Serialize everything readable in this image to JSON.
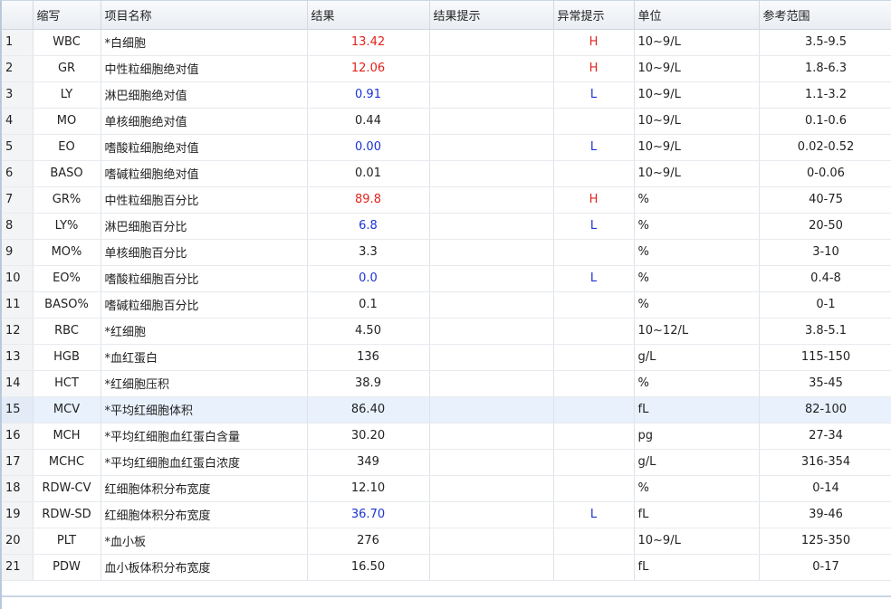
{
  "columns": {
    "abbr": "缩写",
    "name": "项目名称",
    "result": "结果",
    "hint": "结果提示",
    "flag": "异常提示",
    "unit": "单位",
    "range": "参考范围"
  },
  "rows": [
    {
      "no": "1",
      "abbr": "WBC",
      "name": "*白细胞",
      "result": "13.42",
      "hint": "",
      "flag": "H",
      "unit": "10~9/L",
      "range": "3.5-9.5"
    },
    {
      "no": "2",
      "abbr": "GR",
      "name": "中性粒细胞绝对值",
      "result": "12.06",
      "hint": "",
      "flag": "H",
      "unit": "10~9/L",
      "range": "1.8-6.3"
    },
    {
      "no": "3",
      "abbr": "LY",
      "name": "淋巴细胞绝对值",
      "result": "0.91",
      "hint": "",
      "flag": "L",
      "unit": "10~9/L",
      "range": "1.1-3.2"
    },
    {
      "no": "4",
      "abbr": "MO",
      "name": "单核细胞绝对值",
      "result": "0.44",
      "hint": "",
      "flag": "",
      "unit": "10~9/L",
      "range": "0.1-0.6"
    },
    {
      "no": "5",
      "abbr": "EO",
      "name": "嗜酸粒细胞绝对值",
      "result": "0.00",
      "hint": "",
      "flag": "L",
      "unit": "10~9/L",
      "range": "0.02-0.52"
    },
    {
      "no": "6",
      "abbr": "BASO",
      "name": "嗜碱粒细胞绝对值",
      "result": "0.01",
      "hint": "",
      "flag": "",
      "unit": "10~9/L",
      "range": "0-0.06"
    },
    {
      "no": "7",
      "abbr": "GR%",
      "name": "中性粒细胞百分比",
      "result": "89.8",
      "hint": "",
      "flag": "H",
      "unit": "%",
      "range": "40-75"
    },
    {
      "no": "8",
      "abbr": "LY%",
      "name": "淋巴细胞百分比",
      "result": "6.8",
      "hint": "",
      "flag": "L",
      "unit": "%",
      "range": "20-50"
    },
    {
      "no": "9",
      "abbr": "MO%",
      "name": "单核细胞百分比",
      "result": "3.3",
      "hint": "",
      "flag": "",
      "unit": "%",
      "range": "3-10"
    },
    {
      "no": "10",
      "abbr": "EO%",
      "name": "嗜酸粒细胞百分比",
      "result": "0.0",
      "hint": "",
      "flag": "L",
      "unit": "%",
      "range": "0.4-8"
    },
    {
      "no": "11",
      "abbr": "BASO%",
      "name": "嗜碱粒细胞百分比",
      "result": "0.1",
      "hint": "",
      "flag": "",
      "unit": "%",
      "range": "0-1"
    },
    {
      "no": "12",
      "abbr": "RBC",
      "name": "*红细胞",
      "result": "4.50",
      "hint": "",
      "flag": "",
      "unit": "10~12/L",
      "range": "3.8-5.1"
    },
    {
      "no": "13",
      "abbr": "HGB",
      "name": "*血红蛋白",
      "result": "136",
      "hint": "",
      "flag": "",
      "unit": "g/L",
      "range": "115-150"
    },
    {
      "no": "14",
      "abbr": "HCT",
      "name": "*红细胞压积",
      "result": "38.9",
      "hint": "",
      "flag": "",
      "unit": "%",
      "range": "35-45"
    },
    {
      "no": "15",
      "abbr": "MCV",
      "name": "*平均红细胞体积",
      "result": "86.40",
      "hint": "",
      "flag": "",
      "unit": "fL",
      "range": "82-100",
      "selected": true
    },
    {
      "no": "16",
      "abbr": "MCH",
      "name": "*平均红细胞血红蛋白含量",
      "result": "30.20",
      "hint": "",
      "flag": "",
      "unit": "pg",
      "range": "27-34"
    },
    {
      "no": "17",
      "abbr": "MCHC",
      "name": "*平均红细胞血红蛋白浓度",
      "result": "349",
      "hint": "",
      "flag": "",
      "unit": "g/L",
      "range": "316-354"
    },
    {
      "no": "18",
      "abbr": "RDW-CV",
      "name": "红细胞体积分布宽度",
      "result": "12.10",
      "hint": "",
      "flag": "",
      "unit": "%",
      "range": "0-14"
    },
    {
      "no": "19",
      "abbr": "RDW-SD",
      "name": "红细胞体积分布宽度",
      "result": "36.70",
      "hint": "",
      "flag": "L",
      "unit": "fL",
      "range": "39-46"
    },
    {
      "no": "20",
      "abbr": "PLT",
      "name": "*血小板",
      "result": "276",
      "hint": "",
      "flag": "",
      "unit": "10~9/L",
      "range": "125-350"
    },
    {
      "no": "21",
      "abbr": "PDW",
      "name": "血小板体积分布宽度",
      "result": "16.50",
      "hint": "",
      "flag": "",
      "unit": "fL",
      "range": "0-17"
    }
  ],
  "colors": {
    "high": "#e0231b",
    "low": "#1c32d4",
    "selected_row": "#e8f1fc"
  }
}
